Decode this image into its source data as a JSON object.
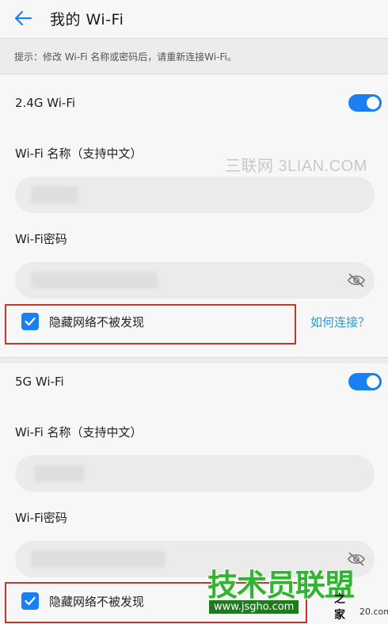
{
  "header": {
    "title": "我的 Wi-Fi"
  },
  "hint": {
    "text": "提示：修改 Wi-Fi 名称或密码后，请重新连接Wi-Fi。"
  },
  "sections": [
    {
      "title": "2.4G Wi-Fi",
      "enabled": true,
      "name_label": "Wi-Fi 名称（支持中文）",
      "password_label": "Wi-Fi密码",
      "hidden_label": "隐藏网络不被发现",
      "hidden_checked": true,
      "help_link": "如何连接？"
    },
    {
      "title": "5G Wi-Fi",
      "enabled": true,
      "name_label": "Wi-Fi 名称（支持中文）",
      "password_label": "Wi-Fi密码",
      "hidden_label": "隐藏网络不被发现",
      "hidden_checked": true
    }
  ],
  "watermarks": {
    "top": "三联网 3LIAN.COM",
    "bottom_big": "技术员联盟",
    "bottom_url": "www.jsgho.com",
    "bottom_side": "之家",
    "bottom_side2": "20.com"
  },
  "colors": {
    "accent": "#1a7ff0",
    "link": "#2a9bd8",
    "highlight": "#c0392b"
  },
  "icons": {
    "back": "arrow-left-icon",
    "eye": "eye-off-icon",
    "check": "check-icon"
  }
}
